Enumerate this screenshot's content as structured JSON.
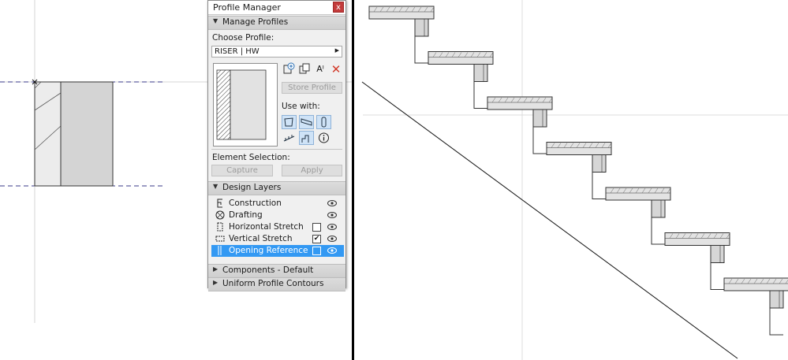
{
  "panel": {
    "title": "Profile Manager",
    "close_glyph": "x",
    "manage_section": "Manage Profiles",
    "choose_label": "Choose Profile:",
    "profile_value": "RISER | HW",
    "store_button": "Store Profile",
    "use_with_label": "Use with:",
    "element_selection_label": "Element Selection:",
    "capture_button": "Capture",
    "apply_button": "Apply",
    "design_layers_section": "Design Layers",
    "layers": [
      {
        "name": "Construction",
        "checkbox": false,
        "checked": false,
        "icon": "construction-layer-icon"
      },
      {
        "name": "Drafting",
        "checkbox": false,
        "checked": false,
        "icon": "drafting-layer-icon"
      },
      {
        "name": "Horizontal Stretch",
        "checkbox": true,
        "checked": false,
        "icon": "horizontal-stretch-icon"
      },
      {
        "name": "Vertical Stretch",
        "checkbox": true,
        "checked": true,
        "icon": "vertical-stretch-icon"
      },
      {
        "name": "Opening Reference",
        "checkbox": true,
        "checked": false,
        "icon": "opening-reference-icon",
        "selected": true
      }
    ],
    "components_section": "Components - Default",
    "contours_section": "Uniform Profile Contours"
  },
  "colors": {
    "selection": "#3399f3",
    "close_button": "#c33b3b",
    "use_with_active": "#cfe3f7"
  }
}
